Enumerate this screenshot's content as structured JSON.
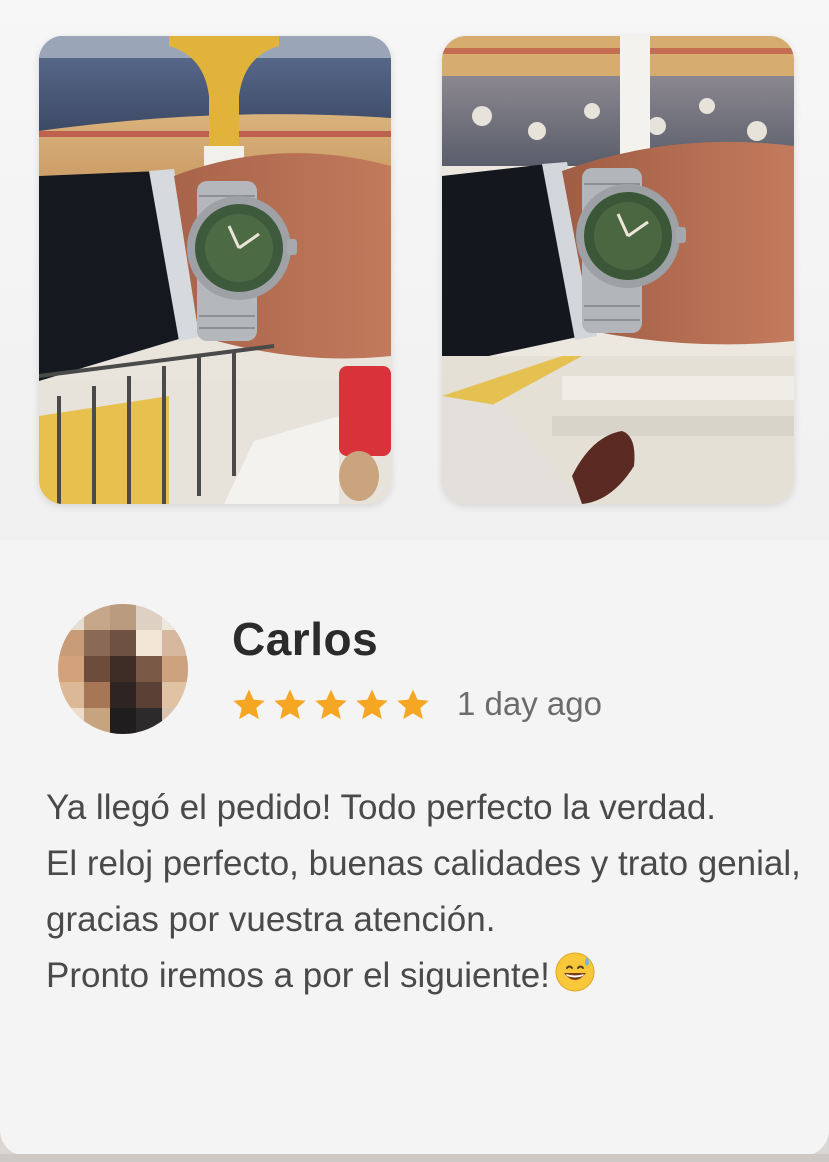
{
  "review": {
    "name": "Carlos",
    "rating": 5,
    "time": "1 day ago",
    "text_lines": [
      "Ya llegó el pedido! Todo perfecto la verdad.",
      "El reloj perfecto, buenas calidades y trato genial, gracias por vuestra atención.",
      "Pronto iremos a por el siguiente!"
    ],
    "emoji": "grinning-face-with-sweat-icon"
  },
  "colors": {
    "star": "#f5a623",
    "name": "#2b2b2b",
    "body_text": "#4a4a4a",
    "card_background": "#f4f4f4"
  },
  "photos": [
    {
      "icon": "wristwatch-photo"
    },
    {
      "icon": "wristwatch-photo"
    }
  ]
}
